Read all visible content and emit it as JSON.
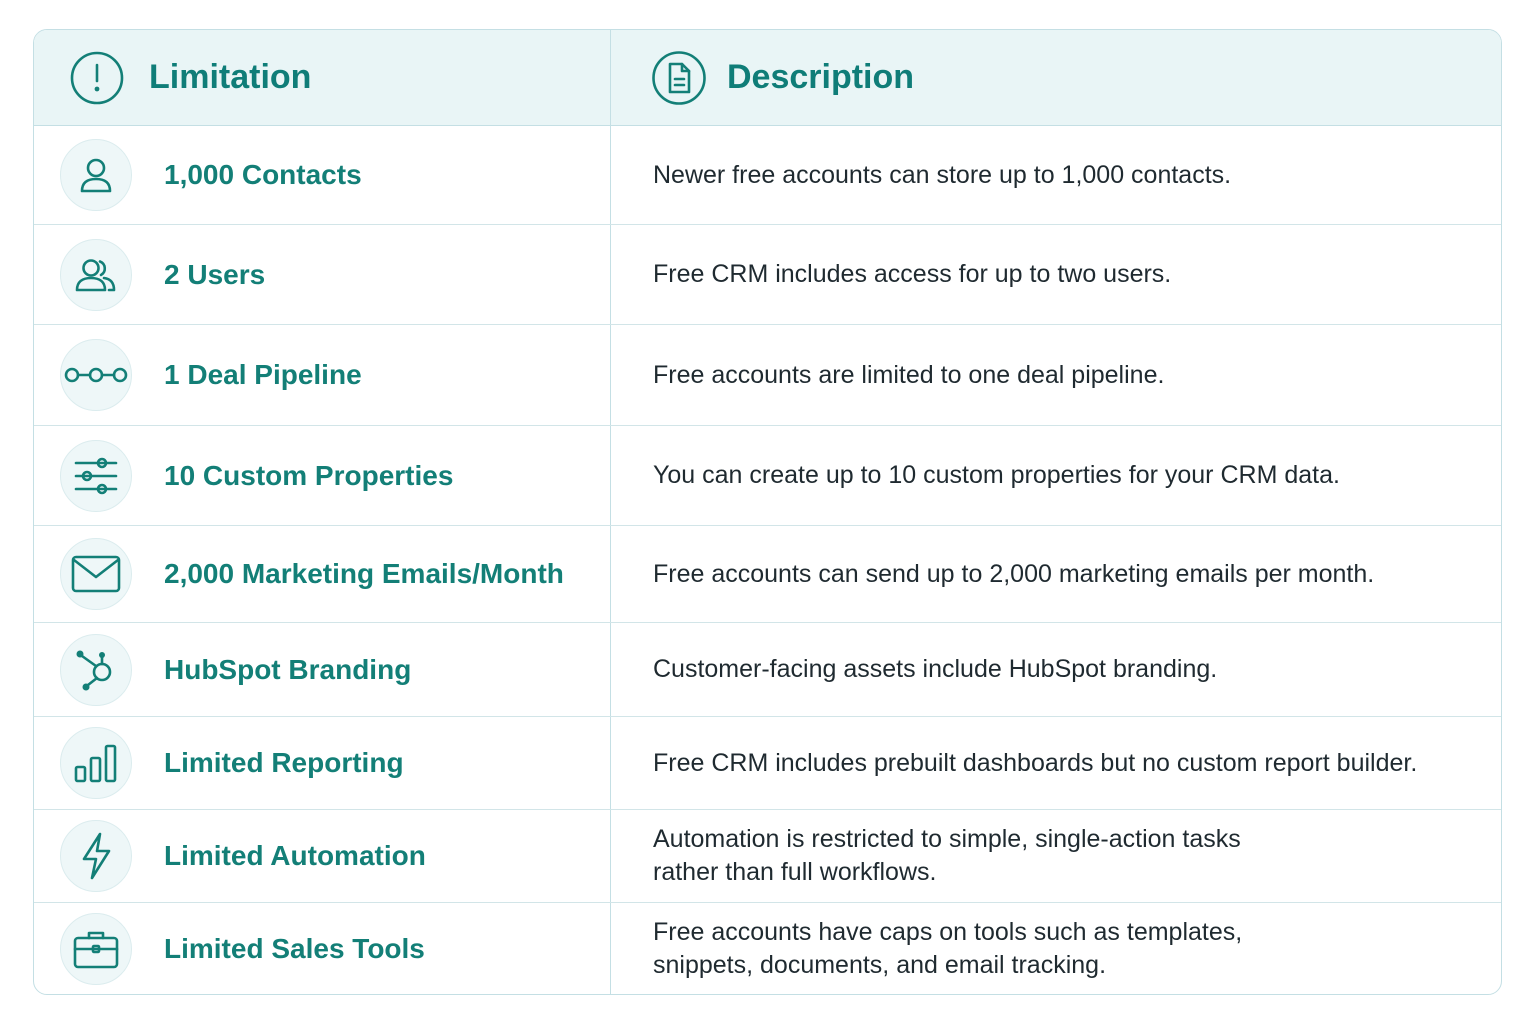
{
  "header": {
    "limitation_label": "Limitation",
    "description_label": "Description",
    "limitation_icon": "exclamation-circle-icon",
    "description_icon": "document-icon"
  },
  "colors": {
    "accent": "#137f77",
    "header_bg": "#e9f5f6",
    "border": "#c4dfe4",
    "text": "#1f2a30"
  },
  "rows": [
    {
      "icon": "user-icon",
      "limitation": "1,000 Contacts",
      "description": "Newer free accounts can store up to 1,000 contacts."
    },
    {
      "icon": "users-icon",
      "limitation": "2 Users",
      "description": "Free CRM includes access for up to two users."
    },
    {
      "icon": "pipeline-icon",
      "limitation": "1 Deal Pipeline",
      "description": "Free accounts are limited to one deal pipeline."
    },
    {
      "icon": "sliders-icon",
      "limitation": "10 Custom Properties",
      "description": "You can create up to 10 custom properties for your CRM data."
    },
    {
      "icon": "mail-icon",
      "limitation": "2,000 Marketing Emails/Month",
      "description": "Free accounts can send up to 2,000 marketing emails per month."
    },
    {
      "icon": "hubspot-icon",
      "limitation": "HubSpot Branding",
      "description": "Customer-facing assets include HubSpot branding."
    },
    {
      "icon": "bar-chart-icon",
      "limitation": "Limited Reporting",
      "description": "Free CRM includes prebuilt dashboards but no custom report builder."
    },
    {
      "icon": "lightning-icon",
      "limitation": "Limited Automation",
      "description": "Automation is restricted to simple, single-action tasks\nrather than full workflows."
    },
    {
      "icon": "briefcase-icon",
      "limitation": "Limited Sales Tools",
      "description": "Free accounts have caps on tools such as templates,\nsnippets, documents, and email tracking."
    }
  ]
}
